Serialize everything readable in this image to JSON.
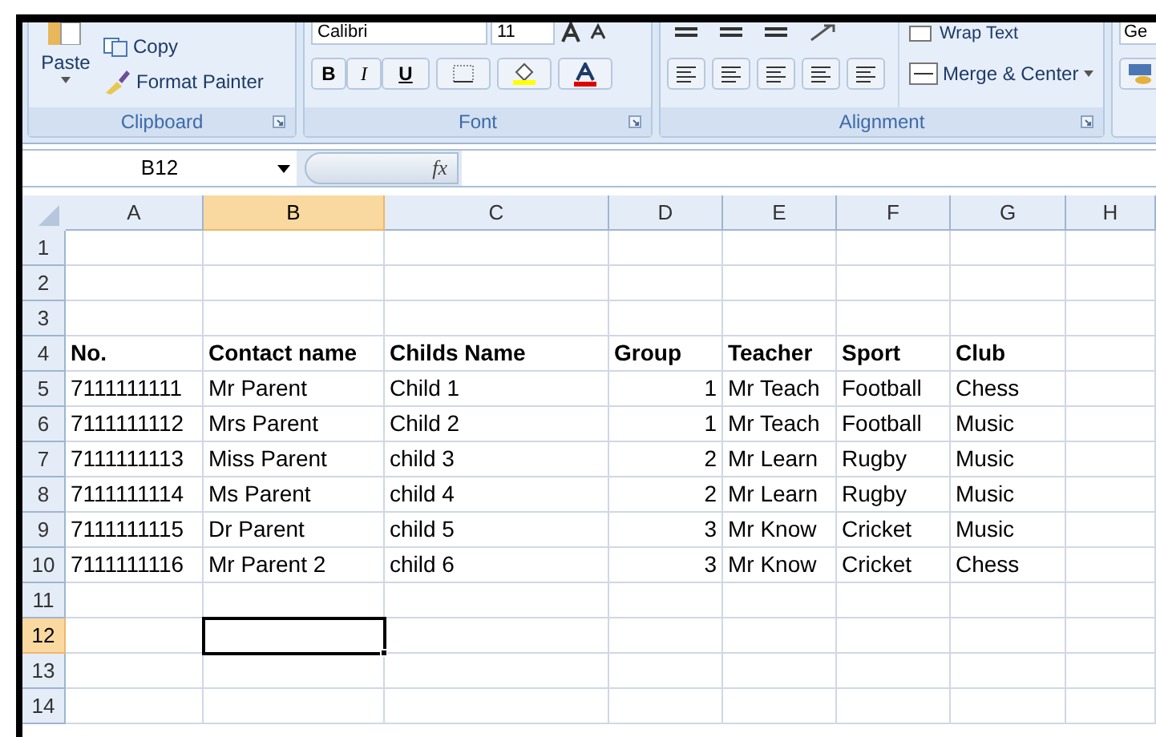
{
  "ribbon": {
    "groups": [
      {
        "kind": "clipboard",
        "label": "Clipboard",
        "paste": "Paste",
        "copy": "Copy",
        "format_painter": "Format Painter"
      },
      {
        "kind": "font",
        "label": "Font",
        "font_name": "Calibri",
        "font_size": "11",
        "bold": "B",
        "italic": "I",
        "underline": "U"
      },
      {
        "kind": "alignment",
        "label": "Alignment",
        "wrap_text": "Wrap Text",
        "merge_center": "Merge & Center"
      },
      {
        "kind": "number",
        "format": "Ge"
      }
    ]
  },
  "formula_bar": {
    "name_box": "B12",
    "fx": "fx"
  },
  "columns": [
    {
      "label": "A",
      "selected": false
    },
    {
      "label": "B",
      "selected": true
    },
    {
      "label": "C",
      "selected": false
    },
    {
      "label": "D",
      "selected": false
    },
    {
      "label": "E",
      "selected": false
    },
    {
      "label": "F",
      "selected": false
    },
    {
      "label": "G",
      "selected": false
    },
    {
      "label": "H",
      "selected": false
    }
  ],
  "rows": [
    {
      "number": "1",
      "selected": false
    },
    {
      "number": "2",
      "selected": false
    },
    {
      "number": "3",
      "selected": false
    },
    {
      "number": "4",
      "selected": false,
      "cells": [
        {
          "kind": "heading",
          "text": "No."
        },
        {
          "kind": "heading",
          "text": "Contact name"
        },
        {
          "kind": "heading",
          "text": "Childs Name"
        },
        {
          "kind": "heading",
          "text": "Group"
        },
        {
          "kind": "heading",
          "text": "Teacher"
        },
        {
          "kind": "heading",
          "text": "Sport"
        },
        {
          "kind": "heading",
          "text": "Club"
        }
      ]
    },
    {
      "number": "5",
      "selected": false,
      "cells": [
        {
          "kind": "text",
          "text": "7111111111"
        },
        {
          "kind": "text",
          "text": "Mr Parent"
        },
        {
          "kind": "text",
          "text": "Child 1"
        },
        {
          "kind": "number",
          "text": "1"
        },
        {
          "kind": "text",
          "text": "Mr Teach"
        },
        {
          "kind": "text",
          "text": "Football"
        },
        {
          "kind": "text",
          "text": "Chess"
        }
      ]
    },
    {
      "number": "6",
      "selected": false,
      "cells": [
        {
          "kind": "text",
          "text": "7111111112"
        },
        {
          "kind": "text",
          "text": "Mrs Parent"
        },
        {
          "kind": "text",
          "text": "Child 2"
        },
        {
          "kind": "number",
          "text": "1"
        },
        {
          "kind": "text",
          "text": "Mr Teach"
        },
        {
          "kind": "text",
          "text": "Football"
        },
        {
          "kind": "text",
          "text": "Music"
        }
      ]
    },
    {
      "number": "7",
      "selected": false,
      "cells": [
        {
          "kind": "text",
          "text": "7111111113"
        },
        {
          "kind": "text",
          "text": "Miss Parent"
        },
        {
          "kind": "text",
          "text": "child 3"
        },
        {
          "kind": "number",
          "text": "2"
        },
        {
          "kind": "text",
          "text": "Mr Learn"
        },
        {
          "kind": "text",
          "text": "Rugby"
        },
        {
          "kind": "text",
          "text": "Music"
        }
      ]
    },
    {
      "number": "8",
      "selected": false,
      "cells": [
        {
          "kind": "text",
          "text": "7111111114"
        },
        {
          "kind": "text",
          "text": "Ms Parent"
        },
        {
          "kind": "text",
          "text": "child 4"
        },
        {
          "kind": "number",
          "text": "2"
        },
        {
          "kind": "text",
          "text": "Mr Learn"
        },
        {
          "kind": "text",
          "text": "Rugby"
        },
        {
          "kind": "text",
          "text": "Music"
        }
      ]
    },
    {
      "number": "9",
      "selected": false,
      "cells": [
        {
          "kind": "text",
          "text": "7111111115"
        },
        {
          "kind": "text",
          "text": "Dr Parent"
        },
        {
          "kind": "text",
          "text": "child 5"
        },
        {
          "kind": "number",
          "text": "3"
        },
        {
          "kind": "text",
          "text": "Mr Know"
        },
        {
          "kind": "text",
          "text": "Cricket"
        },
        {
          "kind": "text",
          "text": "Music"
        }
      ]
    },
    {
      "number": "10",
      "selected": false,
      "cells": [
        {
          "kind": "text",
          "text": "7111111116"
        },
        {
          "kind": "text",
          "text": "Mr Parent 2"
        },
        {
          "kind": "text",
          "text": "child 6"
        },
        {
          "kind": "number",
          "text": "3"
        },
        {
          "kind": "text",
          "text": "Mr Know"
        },
        {
          "kind": "text",
          "text": "Cricket"
        },
        {
          "kind": "text",
          "text": "Chess"
        }
      ]
    },
    {
      "number": "11",
      "selected": false
    },
    {
      "number": "12",
      "selected": true
    },
    {
      "number": "13",
      "selected": false
    },
    {
      "number": "14",
      "selected": false
    }
  ]
}
